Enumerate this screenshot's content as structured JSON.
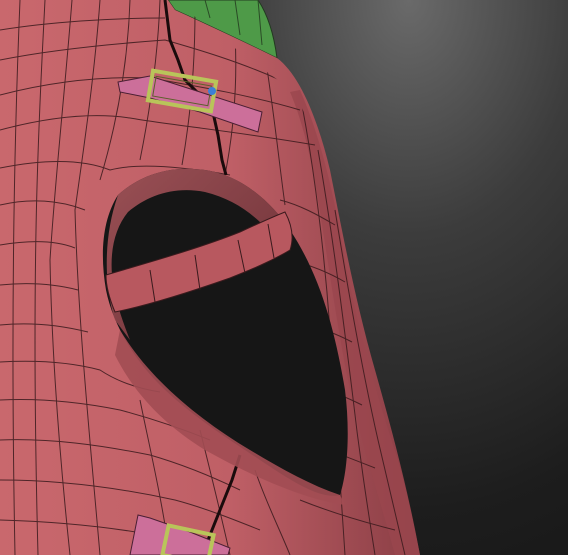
{
  "viewport": {
    "background": "#1b1b1b",
    "mesh_color": "#c7646a",
    "mesh_shadow_color": "#8f4046",
    "wire_color": "#2a1416",
    "accent_mesh_color": "#4fa04a",
    "strap_color": "#c86a94",
    "buckle_color": "#b8c25a",
    "gizmo_color": "#3d7fd6"
  },
  "objects": {
    "main_mesh": "hood-mesh",
    "accent_mesh": "green-mesh",
    "buckles": [
      "buckle-top",
      "buckle-bottom"
    ]
  }
}
